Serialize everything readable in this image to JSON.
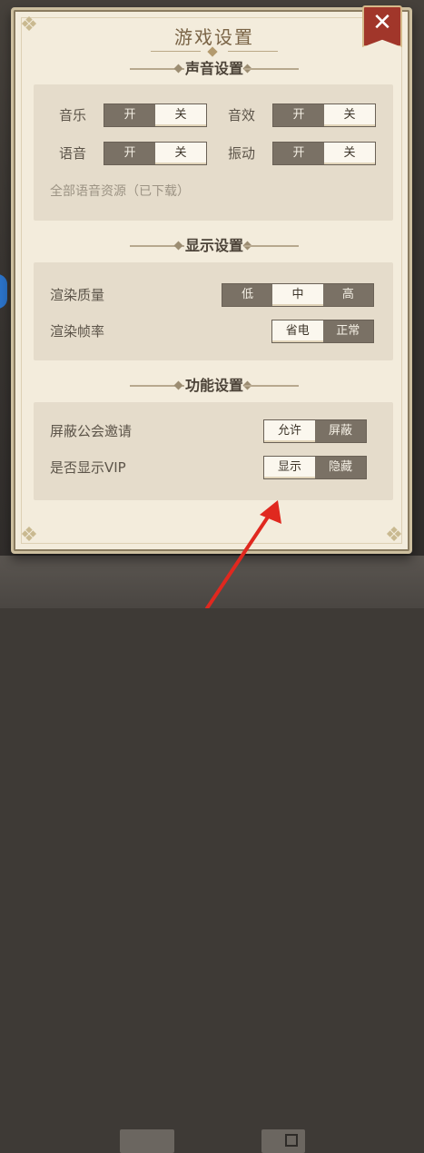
{
  "title": "游戏设置",
  "close": {
    "symbol": "✕"
  },
  "sections": {
    "sound": {
      "heading": "声音设置",
      "rows": [
        {
          "label": "音乐",
          "on": "开",
          "off": "关",
          "selected": "关"
        },
        {
          "label": "音效",
          "on": "开",
          "off": "关",
          "selected": "关"
        },
        {
          "label": "语音",
          "on": "开",
          "off": "关",
          "selected": "关"
        },
        {
          "label": "振动",
          "on": "开",
          "off": "关",
          "selected": "关"
        }
      ],
      "resource_note": "全部语音资源（已下载）"
    },
    "display": {
      "heading": "显示设置",
      "quality": {
        "label": "渲染质量",
        "options": [
          "低",
          "中",
          "高"
        ],
        "selected": "中"
      },
      "framerate": {
        "label": "渲染帧率",
        "options": [
          "省电",
          "正常"
        ],
        "selected": "省电"
      }
    },
    "function": {
      "heading": "功能设置",
      "guild_invite": {
        "label": "屏蔽公会邀请",
        "options": [
          "允许",
          "屏蔽"
        ],
        "selected": "允许"
      },
      "show_vip": {
        "label": "是否显示VIP",
        "options": [
          "显示",
          "隐藏"
        ],
        "selected": "显示"
      }
    }
  },
  "colors": {
    "panel": "#f3ecdc",
    "close_button": "#a1362a",
    "selected_segment": "#fbf7ee",
    "unselected_segment": "#7a7165",
    "annotation_arrow": "#e0281f"
  }
}
